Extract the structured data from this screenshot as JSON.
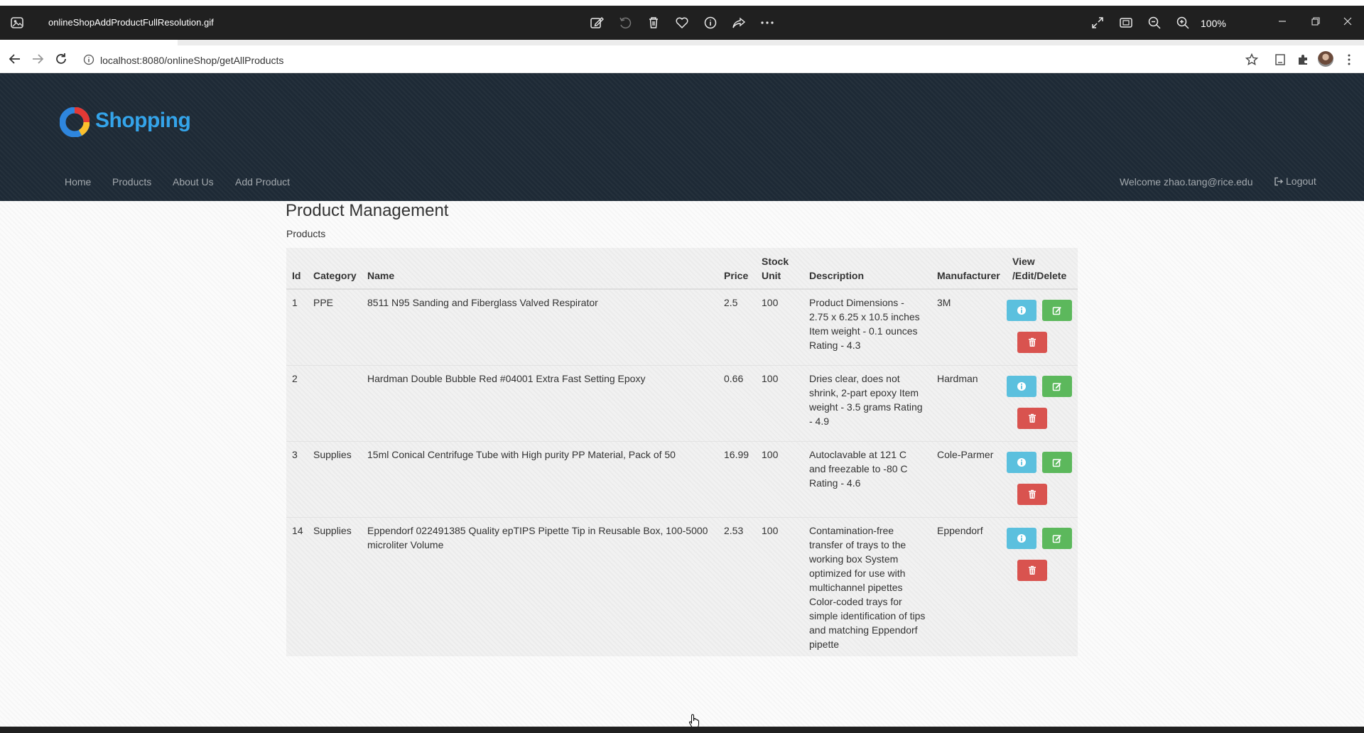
{
  "viewer": {
    "file_name": "onlineShopAddProductFullResolution.gif",
    "zoom": "100%"
  },
  "browser": {
    "url": "localhost:8080/onlineShop/getAllProducts"
  },
  "site": {
    "brand": "Shopping",
    "nav": [
      "Home",
      "Products",
      "About Us",
      "Add Product"
    ],
    "welcome": "Welcome zhao.tang@rice.edu",
    "logout": "Logout"
  },
  "page": {
    "title": "Product Management",
    "subtitle": "Products"
  },
  "table": {
    "headers": {
      "id": "Id",
      "category": "Category",
      "name": "Name",
      "price": "Price",
      "stock_line1": "Stock",
      "stock_line2": "Unit",
      "description": "Description",
      "manufacturer": "Manufacturer",
      "actions_line1": "View",
      "actions_line2": "/Edit/Delete"
    },
    "rows": [
      {
        "id": "1",
        "category": "PPE",
        "name": "8511 N95 Sanding and Fiberglass Valved Respirator",
        "price": "2.5",
        "stock": "100",
        "description": "Product Dimensions - 2.75 x 6.25 x 10.5 inches Item weight - 0.1 ounces Rating - 4.3",
        "manufacturer": "3M"
      },
      {
        "id": "2",
        "category": "",
        "name": "Hardman Double Bubble Red #04001 Extra Fast Setting Epoxy",
        "price": "0.66",
        "stock": "100",
        "description": "Dries clear, does not shrink, 2-part epoxy Item weight - 3.5 grams Rating - 4.9",
        "manufacturer": "Hardman"
      },
      {
        "id": "3",
        "category": "Supplies",
        "name": "15ml Conical Centrifuge Tube with High purity PP Material, Pack of 50",
        "price": "16.99",
        "stock": "100",
        "description": "Autoclavable at 121 C and freezable to -80 C Rating - 4.6",
        "manufacturer": "Cole-Parmer"
      },
      {
        "id": "14",
        "category": "Supplies",
        "name": "Eppendorf 022491385 Quality epTIPS Pipette Tip in Reusable Box, 100-5000 microliter Volume",
        "price": "2.53",
        "stock": "100",
        "description": "Contamination-free transfer of trays to the working box System optimized for use with multichannel pipettes Color-coded trays for simple identification of tips and matching Eppendorf pipette",
        "manufacturer": "Eppendorf"
      }
    ]
  },
  "colors": {
    "navbar_bg": "#1e2a36",
    "brand_blue": "#34a4ea",
    "view_button": "#5bc0de",
    "edit_button": "#5cb85c",
    "delete_button": "#d9534f"
  },
  "icons": {
    "view": "info-circle-icon",
    "edit": "edit-icon",
    "delete": "trash-icon",
    "logout": "logout-icon"
  }
}
